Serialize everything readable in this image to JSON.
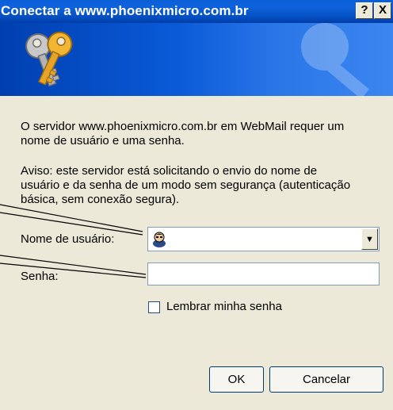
{
  "window": {
    "title": "Conectar a www.phoenixmicro.com.br",
    "help_label": "?",
    "close_label": "X"
  },
  "message": {
    "server_text": "O servidor www.phoenixmicro.com.br em WebMail requer um\nnome de usuário e uma senha.",
    "warning_text": "Aviso: este servidor está solicitando o envio do nome de\nusuário e da senha de um modo sem segurança (autenticação\nbásica, sem conexão segura)."
  },
  "form": {
    "username_label": "Nome de usuário:",
    "username_value": "",
    "password_label": "Senha:",
    "password_value": "",
    "remember_label": "Lembrar minha senha",
    "remember_checked": false
  },
  "buttons": {
    "ok": "OK",
    "cancel": "Cancelar"
  },
  "icons": [
    "keys-icon",
    "user-icon",
    "dropdown-arrow-icon",
    "help-icon",
    "close-icon"
  ]
}
